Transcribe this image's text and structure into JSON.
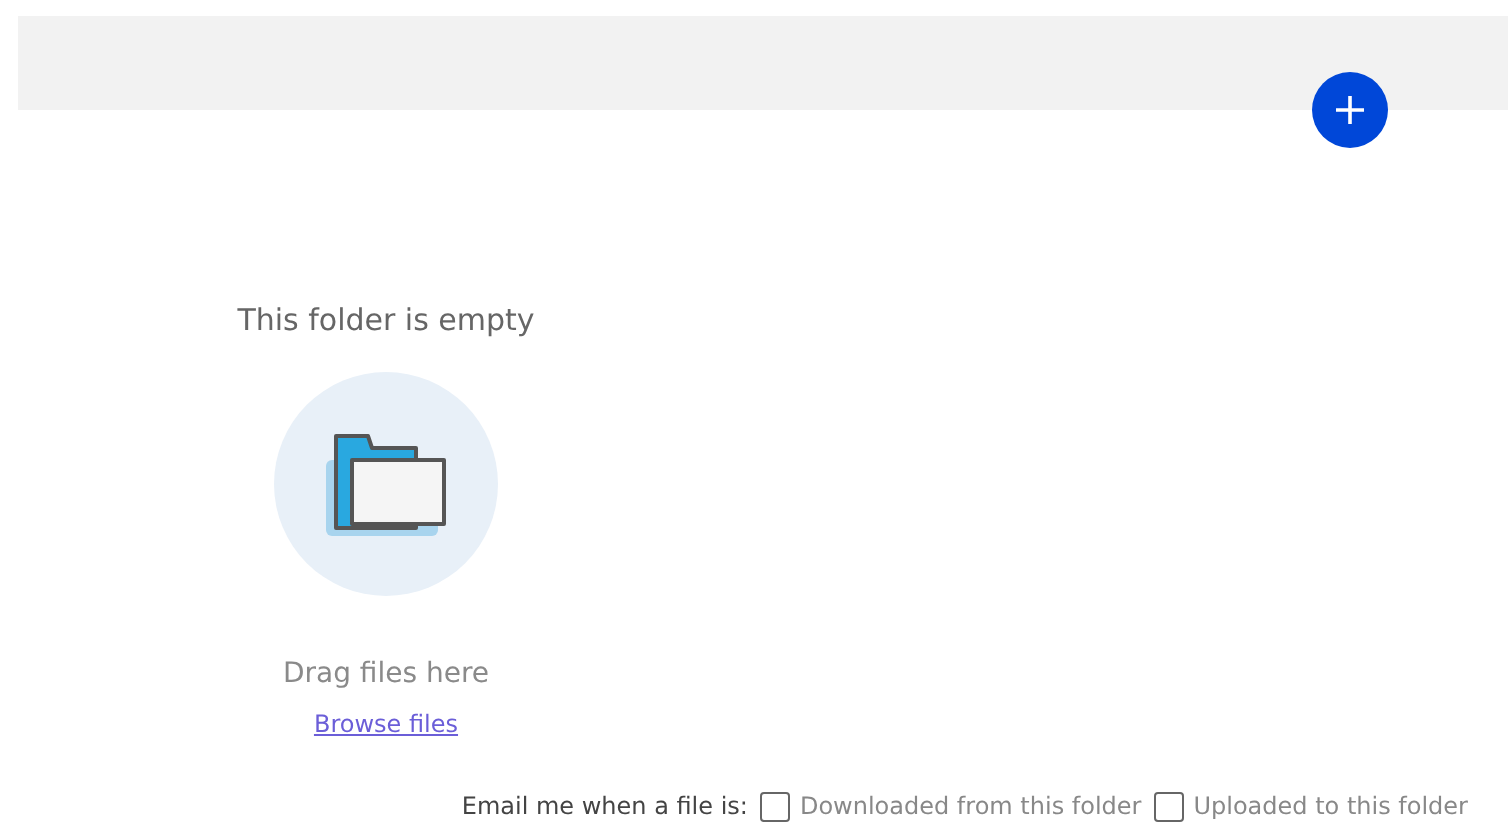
{
  "empty_state": {
    "title": "This folder is empty",
    "hint": "Drag files here",
    "link": "Browse files"
  },
  "notify": {
    "label": "Email me when a file is:",
    "options": [
      {
        "label": "Downloaded from this folder",
        "checked": false
      },
      {
        "label": "Uploaded to this folder",
        "checked": false
      }
    ]
  }
}
